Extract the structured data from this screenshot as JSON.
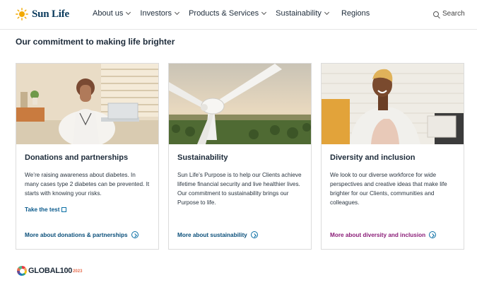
{
  "brand": {
    "name": "Sun Life",
    "accent": "#f2a900",
    "primary": "#0a3a5c"
  },
  "nav": {
    "items": [
      {
        "label": "About us",
        "has_dropdown": true
      },
      {
        "label": "Investors",
        "has_dropdown": true
      },
      {
        "label": "Products & Services",
        "has_dropdown": true
      },
      {
        "label": "Sustainability",
        "has_dropdown": true
      },
      {
        "label": "Regions",
        "has_dropdown": false
      }
    ],
    "search_label": "Search"
  },
  "main": {
    "heading": "Our commitment to making life brighter",
    "cards": [
      {
        "title": "Donations and partnerships",
        "description": "We’re raising awareness about diabetes. In many cases type 2 diabetes can be prevented. It starts with knowing your risks.",
        "link_label": "Take the test",
        "more_label": "More about donations & partnerships"
      },
      {
        "title": "Sustainability",
        "description": "Sun Life’s Purpose is to help our Clients achieve lifetime financial security and live healthier lives. Our commitment to sustainability brings our Purpose to life.",
        "more_label": "More about sustainability"
      },
      {
        "title": "Diversity and inclusion",
        "description": "We look to our diverse workforce for wide perspectives and creative ideas that make life brighter for our Clients, communities and colleagues.",
        "more_label": "More about diversity and inclusion"
      }
    ]
  },
  "footer": {
    "badge_text": "GLOBAL100",
    "badge_suffix": "2023"
  },
  "icons": {
    "logo": "sun-logo-icon",
    "search": "search-icon",
    "dropdown": "chevron-down-icon",
    "external": "external-link-icon",
    "more": "circle-arrow-icon"
  }
}
